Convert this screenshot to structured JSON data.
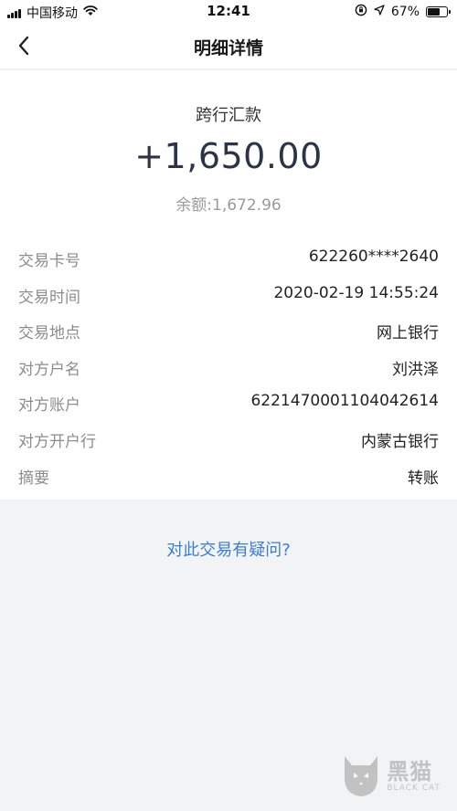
{
  "status_bar": {
    "carrier": "中国移动",
    "time": "12:41",
    "battery_percent": "67%",
    "battery_level": 0.67,
    "icons": [
      "signal-icon",
      "wifi-icon",
      "orientation-lock-icon",
      "location-icon",
      "battery-icon"
    ]
  },
  "nav": {
    "title": "明细详情",
    "back_icon": "chevron-left-icon"
  },
  "transaction": {
    "type": "跨行汇款",
    "amount": "+1,650.00",
    "balance": "余额:1,672.96"
  },
  "details": [
    {
      "label": "交易卡号",
      "value": "622260****2640"
    },
    {
      "label": "交易时间",
      "value": "2020-02-19 14:55:24"
    },
    {
      "label": "交易地点",
      "value": "网上银行"
    },
    {
      "label": "对方户名",
      "value": "刘洪泽"
    },
    {
      "label": "对方账户",
      "value": "6221470001104042614"
    },
    {
      "label": "对方开户行",
      "value": "内蒙古银行"
    },
    {
      "label": "摘要",
      "value": "转账"
    }
  ],
  "query_link": "对此交易有疑问?",
  "watermark": {
    "cn": "黑猫",
    "en": "BLACK CAT"
  },
  "colors": {
    "link": "#3d7ecb",
    "amount": "#2c3445",
    "label": "#8c8c8c",
    "background": "#f2f3f5"
  }
}
